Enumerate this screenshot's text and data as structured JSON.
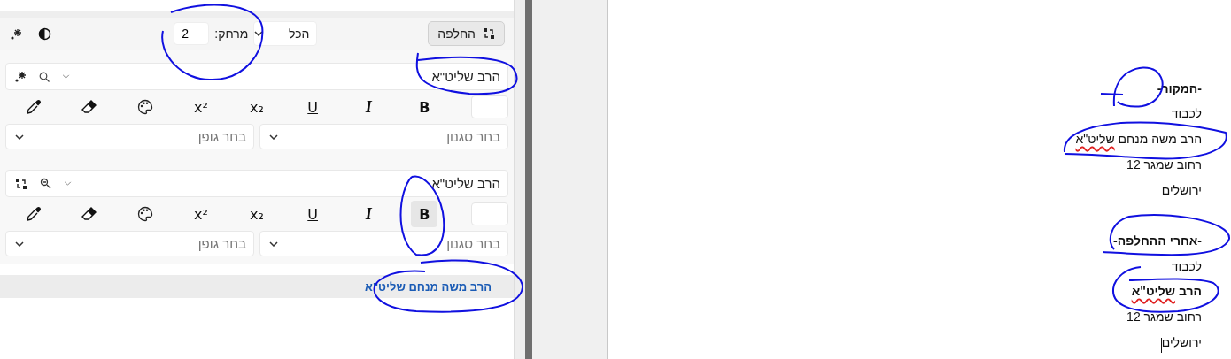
{
  "panel": {
    "toolbar": {
      "replace_button": "החלפה",
      "scope_select": "הכל",
      "distance_label": "מרחק:",
      "distance_value": "2"
    },
    "rules": [
      {
        "kind": "search",
        "find_value": "הרב שליט\"א",
        "tools": [
          {
            "kind": "bold",
            "label": "B",
            "selected": false
          },
          {
            "kind": "italic",
            "label": "I",
            "selected": false
          },
          {
            "kind": "underline",
            "label": "U",
            "selected": false
          },
          {
            "kind": "subscript",
            "label": "x₂",
            "selected": false
          },
          {
            "kind": "superscript",
            "label": "x²",
            "selected": false
          },
          {
            "kind": "palette"
          },
          {
            "kind": "eraser"
          },
          {
            "kind": "eyedropper"
          }
        ],
        "style_placeholder": "בחר סגנון",
        "font_placeholder": "בחר גופן"
      },
      {
        "kind": "replace",
        "find_value": "הרב שליט\"א",
        "tools": [
          {
            "kind": "bold",
            "label": "B",
            "selected": true
          },
          {
            "kind": "italic",
            "label": "I",
            "selected": false
          },
          {
            "kind": "underline",
            "label": "U",
            "selected": false
          },
          {
            "kind": "subscript",
            "label": "x₂",
            "selected": false
          },
          {
            "kind": "superscript",
            "label": "x²",
            "selected": false
          },
          {
            "kind": "palette"
          },
          {
            "kind": "eraser"
          },
          {
            "kind": "eyedropper"
          }
        ],
        "style_placeholder": "בחר סגנון",
        "font_placeholder": "בחר גופן"
      }
    ],
    "result": "הרב משה מנחם שליט\"א"
  },
  "document": {
    "lines": [
      {
        "kind": "heading",
        "parts": [
          {
            "text": "-המקור-",
            "misspelled": false
          }
        ]
      },
      {
        "kind": "plain",
        "parts": [
          {
            "text": "לכבוד",
            "misspelled": false
          }
        ]
      },
      {
        "kind": "plain",
        "parts": [
          {
            "text": "הרב משה מנחם ",
            "misspelled": false
          },
          {
            "text": "שליט\"א",
            "misspelled": true
          }
        ]
      },
      {
        "kind": "plain",
        "parts": [
          {
            "text": "רחוב שמגר 12",
            "misspelled": false
          }
        ]
      },
      {
        "kind": "plain",
        "parts": [
          {
            "text": "ירושלים",
            "misspelled": false
          }
        ]
      },
      {
        "kind": "heading",
        "parts": [
          {
            "text": "-אחרי ההחלפה-",
            "misspelled": false
          }
        ]
      },
      {
        "kind": "plain",
        "parts": [
          {
            "text": "לכבוד",
            "misspelled": false
          }
        ]
      },
      {
        "kind": "bold",
        "parts": [
          {
            "text": "הרב ",
            "misspelled": false
          },
          {
            "text": "שליט\"א",
            "misspelled": true
          }
        ]
      },
      {
        "kind": "plain",
        "parts": [
          {
            "text": "רחוב שמגר 12",
            "misspelled": false
          }
        ]
      },
      {
        "kind": "plain",
        "parts": [
          {
            "text": "ירושלים",
            "misspelled": false
          }
        ],
        "cursor": true
      }
    ]
  }
}
